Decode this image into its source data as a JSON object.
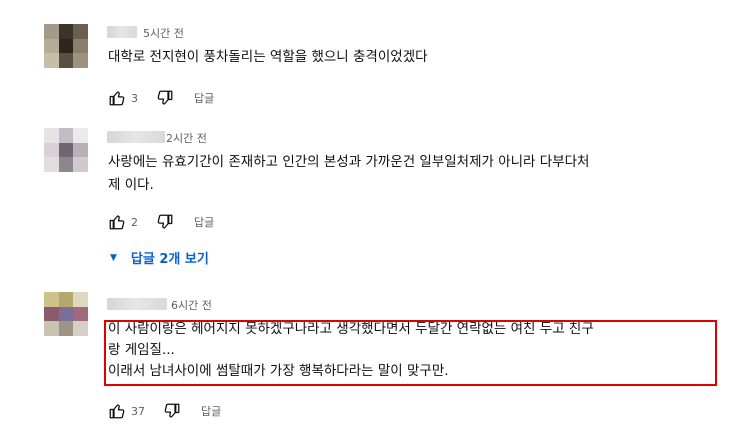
{
  "comments": [
    {
      "time": "5시간 전",
      "text": "대학로 전지현이 풍차돌리는 역할을 했으니 충격이었겠다",
      "likes": "3",
      "reply_label": "답글"
    },
    {
      "time": "2시간 전",
      "text": "사랑에는 유효기간이 존재하고 인간의 본성과 가까운건 일부일처제가 아니라 다부다처\n제 이다.",
      "likes": "2",
      "reply_label": "답글",
      "replies_toggle": "답글 2개 보기"
    },
    {
      "time": "6시간 전",
      "text": "이 사람이랑은 헤어지지 못하겠구나라고 생각했다면서 두달간 연락없는 여친 두고 친구\n랑 게임질...\n이래서 남녀사이에 썸탈때가 가장 행복하다라는 말이 맞구만.",
      "likes": "37",
      "reply_label": "답글"
    }
  ],
  "colors": {
    "highlight_border": "#e00000",
    "link_blue": "#065fd4"
  },
  "icons": [
    "thumbs-up-icon",
    "thumbs-down-icon",
    "caret-down-icon"
  ]
}
